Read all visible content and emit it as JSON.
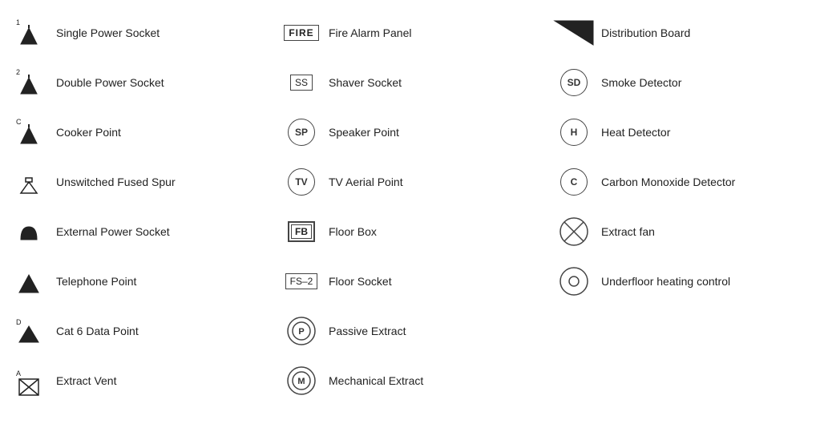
{
  "columns": [
    {
      "id": "col1",
      "items": [
        {
          "id": "single-power-socket",
          "label": "Single Power Socket",
          "symbol_type": "single-power"
        },
        {
          "id": "double-power-socket",
          "label": "Double Power Socket",
          "symbol_type": "double-power"
        },
        {
          "id": "cooker-point",
          "label": "Cooker Point",
          "symbol_type": "cooker"
        },
        {
          "id": "unswitched-fused-spur",
          "label": "Unswitched Fused Spur",
          "symbol_type": "fused-spur"
        },
        {
          "id": "external-power-socket",
          "label": "External Power Socket",
          "symbol_type": "external-power"
        },
        {
          "id": "telephone-point",
          "label": "Telephone Point",
          "symbol_type": "telephone"
        },
        {
          "id": "cat6-data-point",
          "label": "Cat 6 Data Point",
          "symbol_type": "cat6"
        },
        {
          "id": "extract-vent",
          "label": "Extract Vent",
          "symbol_type": "extract-vent"
        }
      ]
    },
    {
      "id": "col2",
      "items": [
        {
          "id": "fire-alarm-panel",
          "label": "Fire Alarm Panel",
          "symbol_type": "fire-alarm"
        },
        {
          "id": "shaver-socket",
          "label": "Shaver Socket",
          "symbol_type": "shaver"
        },
        {
          "id": "speaker-point",
          "label": "Speaker Point",
          "symbol_type": "speaker"
        },
        {
          "id": "tv-aerial-point",
          "label": "TV Aerial Point",
          "symbol_type": "tv"
        },
        {
          "id": "floor-box",
          "label": "Floor Box",
          "symbol_type": "floor-box"
        },
        {
          "id": "floor-socket",
          "label": "Floor Socket",
          "symbol_type": "floor-socket"
        },
        {
          "id": "passive-extract",
          "label": "Passive Extract",
          "symbol_type": "passive"
        },
        {
          "id": "mechanical-extract",
          "label": "Mechanical Extract",
          "symbol_type": "mechanical"
        }
      ]
    },
    {
      "id": "col3",
      "items": [
        {
          "id": "distribution-board",
          "label": "Distribution Board",
          "symbol_type": "dist-board"
        },
        {
          "id": "smoke-detector",
          "label": "Smoke Detector",
          "symbol_type": "smoke"
        },
        {
          "id": "heat-detector",
          "label": "Heat Detector",
          "symbol_type": "heat"
        },
        {
          "id": "carbon-monoxide-detector",
          "label": "Carbon Monoxide Detector",
          "symbol_type": "carbon"
        },
        {
          "id": "extract-fan",
          "label": "Extract fan",
          "symbol_type": "extract-fan"
        },
        {
          "id": "underfloor-heating",
          "label": "Underfloor heating control",
          "symbol_type": "underfloor"
        }
      ]
    }
  ]
}
